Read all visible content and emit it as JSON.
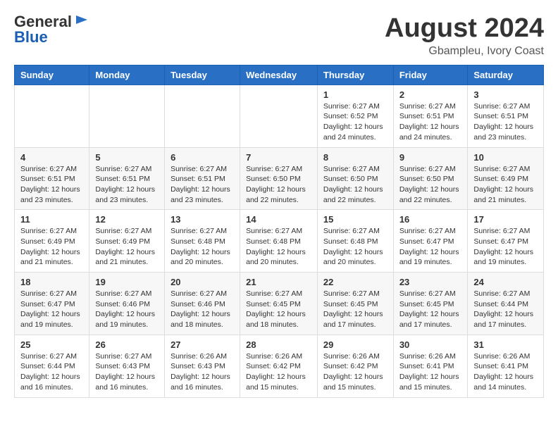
{
  "header": {
    "logo_general": "General",
    "logo_blue": "Blue",
    "month": "August 2024",
    "location": "Gbampleu, Ivory Coast"
  },
  "weekdays": [
    "Sunday",
    "Monday",
    "Tuesday",
    "Wednesday",
    "Thursday",
    "Friday",
    "Saturday"
  ],
  "weeks": [
    [
      {
        "day": "",
        "info": ""
      },
      {
        "day": "",
        "info": ""
      },
      {
        "day": "",
        "info": ""
      },
      {
        "day": "",
        "info": ""
      },
      {
        "day": "1",
        "info": "Sunrise: 6:27 AM\nSunset: 6:52 PM\nDaylight: 12 hours\nand 24 minutes."
      },
      {
        "day": "2",
        "info": "Sunrise: 6:27 AM\nSunset: 6:51 PM\nDaylight: 12 hours\nand 24 minutes."
      },
      {
        "day": "3",
        "info": "Sunrise: 6:27 AM\nSunset: 6:51 PM\nDaylight: 12 hours\nand 23 minutes."
      }
    ],
    [
      {
        "day": "4",
        "info": "Sunrise: 6:27 AM\nSunset: 6:51 PM\nDaylight: 12 hours\nand 23 minutes."
      },
      {
        "day": "5",
        "info": "Sunrise: 6:27 AM\nSunset: 6:51 PM\nDaylight: 12 hours\nand 23 minutes."
      },
      {
        "day": "6",
        "info": "Sunrise: 6:27 AM\nSunset: 6:51 PM\nDaylight: 12 hours\nand 23 minutes."
      },
      {
        "day": "7",
        "info": "Sunrise: 6:27 AM\nSunset: 6:50 PM\nDaylight: 12 hours\nand 22 minutes."
      },
      {
        "day": "8",
        "info": "Sunrise: 6:27 AM\nSunset: 6:50 PM\nDaylight: 12 hours\nand 22 minutes."
      },
      {
        "day": "9",
        "info": "Sunrise: 6:27 AM\nSunset: 6:50 PM\nDaylight: 12 hours\nand 22 minutes."
      },
      {
        "day": "10",
        "info": "Sunrise: 6:27 AM\nSunset: 6:49 PM\nDaylight: 12 hours\nand 21 minutes."
      }
    ],
    [
      {
        "day": "11",
        "info": "Sunrise: 6:27 AM\nSunset: 6:49 PM\nDaylight: 12 hours\nand 21 minutes."
      },
      {
        "day": "12",
        "info": "Sunrise: 6:27 AM\nSunset: 6:49 PM\nDaylight: 12 hours\nand 21 minutes."
      },
      {
        "day": "13",
        "info": "Sunrise: 6:27 AM\nSunset: 6:48 PM\nDaylight: 12 hours\nand 20 minutes."
      },
      {
        "day": "14",
        "info": "Sunrise: 6:27 AM\nSunset: 6:48 PM\nDaylight: 12 hours\nand 20 minutes."
      },
      {
        "day": "15",
        "info": "Sunrise: 6:27 AM\nSunset: 6:48 PM\nDaylight: 12 hours\nand 20 minutes."
      },
      {
        "day": "16",
        "info": "Sunrise: 6:27 AM\nSunset: 6:47 PM\nDaylight: 12 hours\nand 19 minutes."
      },
      {
        "day": "17",
        "info": "Sunrise: 6:27 AM\nSunset: 6:47 PM\nDaylight: 12 hours\nand 19 minutes."
      }
    ],
    [
      {
        "day": "18",
        "info": "Sunrise: 6:27 AM\nSunset: 6:47 PM\nDaylight: 12 hours\nand 19 minutes."
      },
      {
        "day": "19",
        "info": "Sunrise: 6:27 AM\nSunset: 6:46 PM\nDaylight: 12 hours\nand 19 minutes."
      },
      {
        "day": "20",
        "info": "Sunrise: 6:27 AM\nSunset: 6:46 PM\nDaylight: 12 hours\nand 18 minutes."
      },
      {
        "day": "21",
        "info": "Sunrise: 6:27 AM\nSunset: 6:45 PM\nDaylight: 12 hours\nand 18 minutes."
      },
      {
        "day": "22",
        "info": "Sunrise: 6:27 AM\nSunset: 6:45 PM\nDaylight: 12 hours\nand 17 minutes."
      },
      {
        "day": "23",
        "info": "Sunrise: 6:27 AM\nSunset: 6:45 PM\nDaylight: 12 hours\nand 17 minutes."
      },
      {
        "day": "24",
        "info": "Sunrise: 6:27 AM\nSunset: 6:44 PM\nDaylight: 12 hours\nand 17 minutes."
      }
    ],
    [
      {
        "day": "25",
        "info": "Sunrise: 6:27 AM\nSunset: 6:44 PM\nDaylight: 12 hours\nand 16 minutes."
      },
      {
        "day": "26",
        "info": "Sunrise: 6:27 AM\nSunset: 6:43 PM\nDaylight: 12 hours\nand 16 minutes."
      },
      {
        "day": "27",
        "info": "Sunrise: 6:26 AM\nSunset: 6:43 PM\nDaylight: 12 hours\nand 16 minutes."
      },
      {
        "day": "28",
        "info": "Sunrise: 6:26 AM\nSunset: 6:42 PM\nDaylight: 12 hours\nand 15 minutes."
      },
      {
        "day": "29",
        "info": "Sunrise: 6:26 AM\nSunset: 6:42 PM\nDaylight: 12 hours\nand 15 minutes."
      },
      {
        "day": "30",
        "info": "Sunrise: 6:26 AM\nSunset: 6:41 PM\nDaylight: 12 hours\nand 15 minutes."
      },
      {
        "day": "31",
        "info": "Sunrise: 6:26 AM\nSunset: 6:41 PM\nDaylight: 12 hours\nand 14 minutes."
      }
    ]
  ]
}
